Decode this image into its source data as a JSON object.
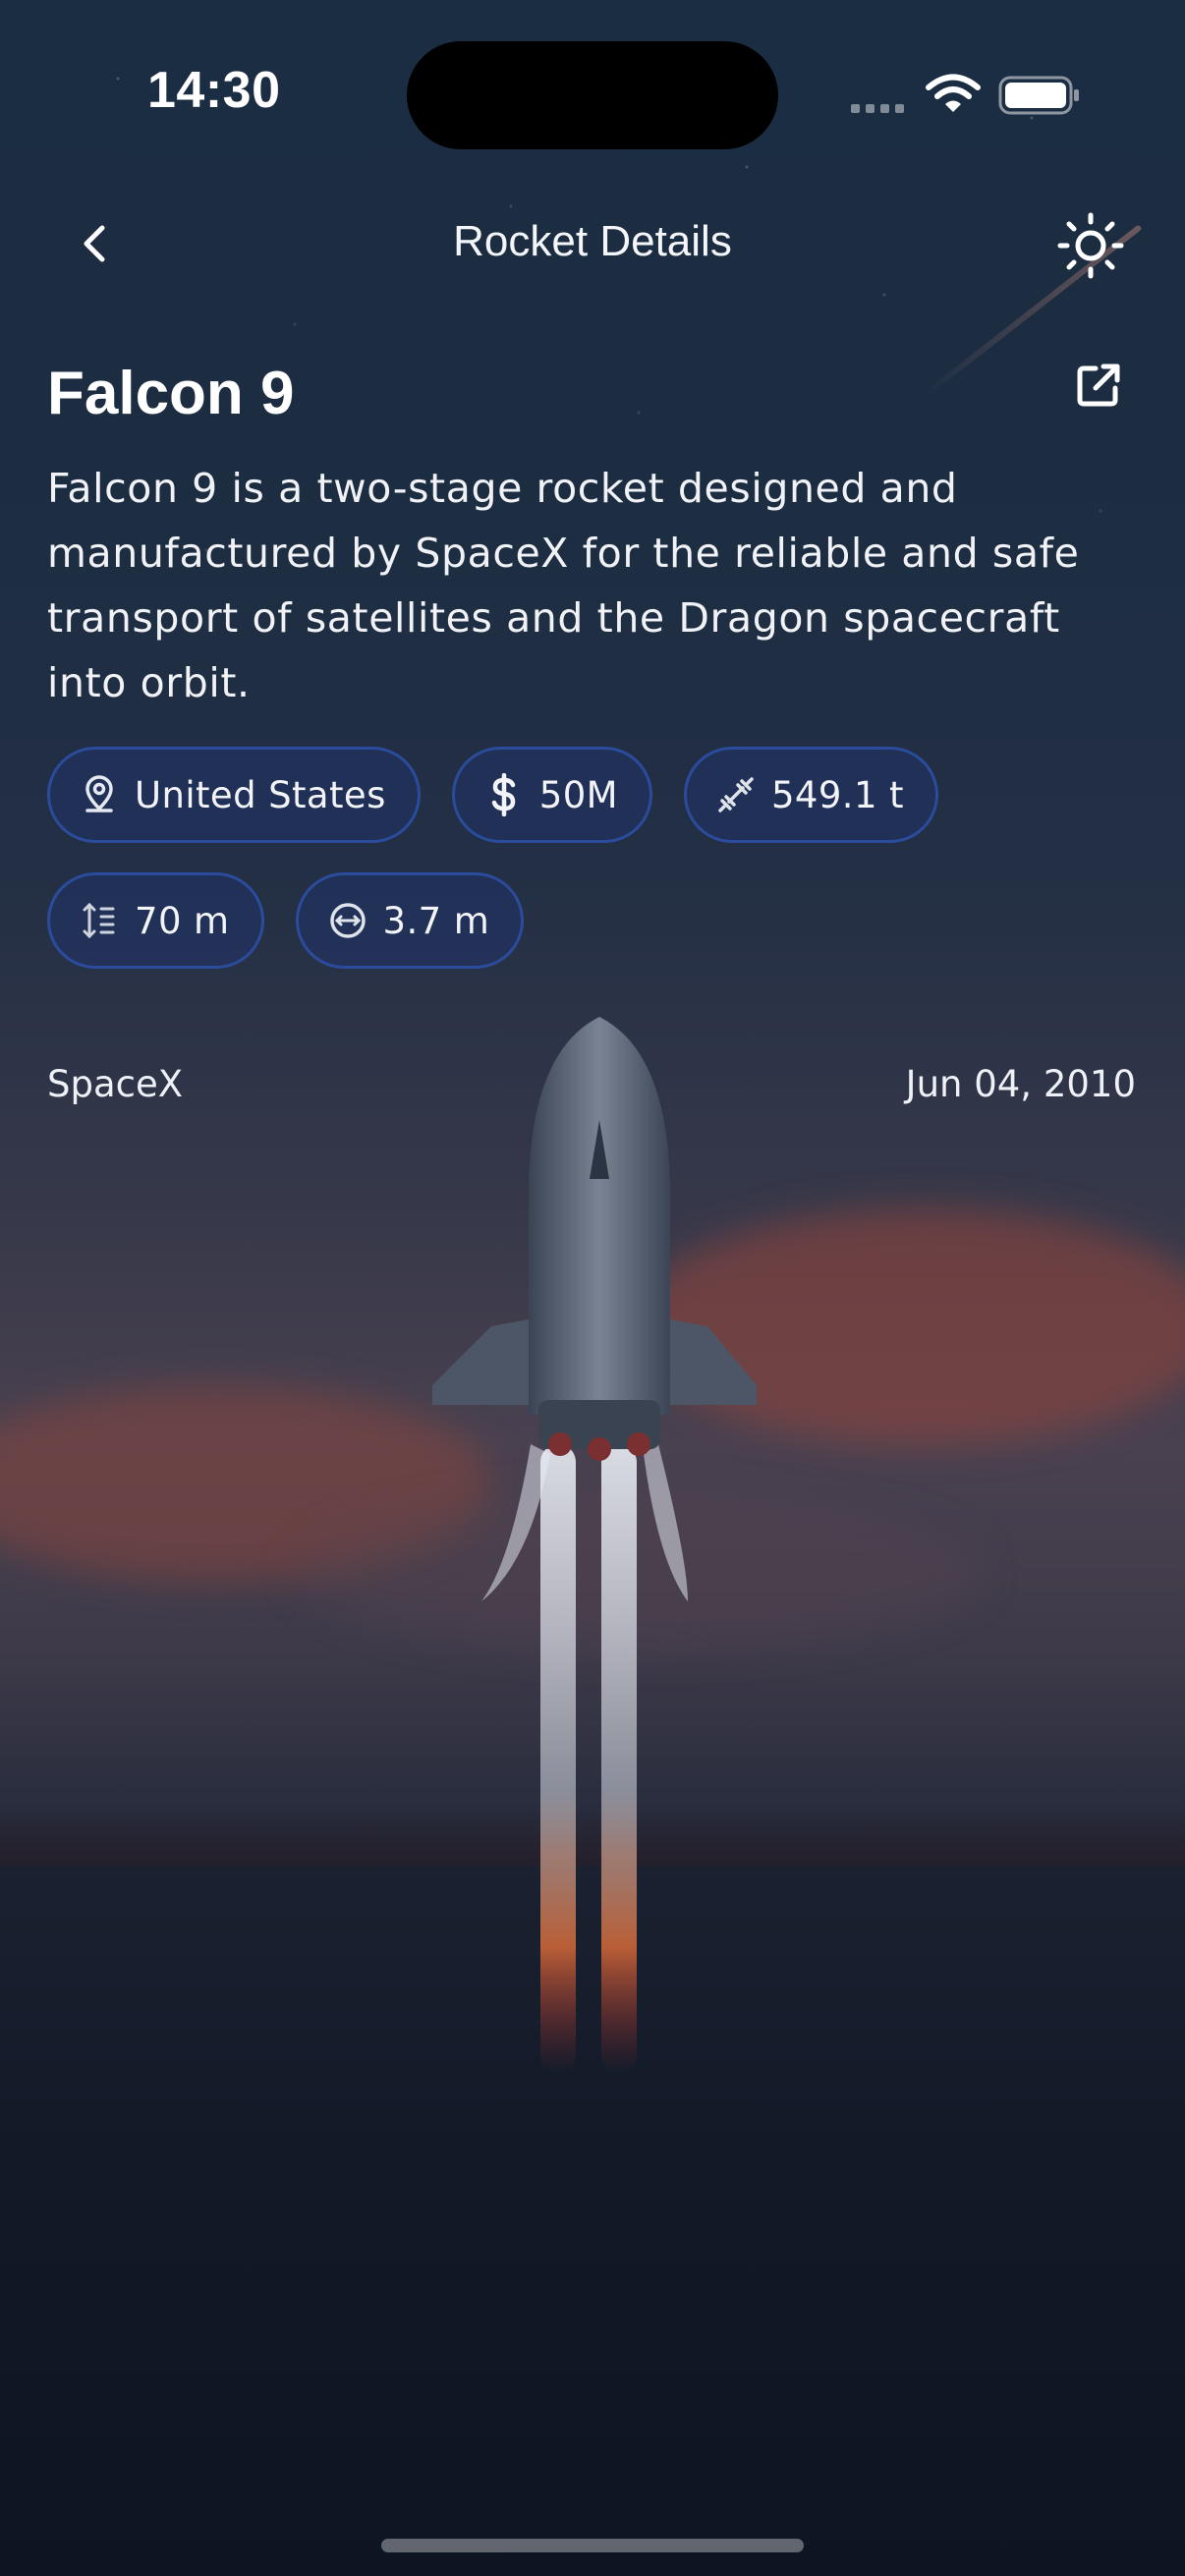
{
  "status_bar": {
    "time": "14:30"
  },
  "header": {
    "title": "Rocket Details",
    "back_icon": "chevron-left-icon",
    "theme_icon": "sun-icon"
  },
  "rocket": {
    "name": "Falcon 9",
    "description": "Falcon 9 is a two-stage rocket designed and manufactured by SpaceX for the reliable and safe transport of satellites and the Dragon spacecraft into orbit.",
    "link_icon": "external-link-icon",
    "chips": [
      {
        "icon": "location-pin-icon",
        "label": "United States"
      },
      {
        "icon": "dollar-icon",
        "label": "50M"
      },
      {
        "icon": "dumbbell-icon",
        "label": "549.1 t"
      },
      {
        "icon": "height-icon",
        "label": "70 m"
      },
      {
        "icon": "diameter-icon",
        "label": "3.7 m"
      }
    ],
    "company": "SpaceX",
    "first_flight": "Jun 04, 2010"
  },
  "colors": {
    "chip_border": "#2b4c9c",
    "chip_fill": "#1e346e",
    "text": "#f2f4f8"
  }
}
